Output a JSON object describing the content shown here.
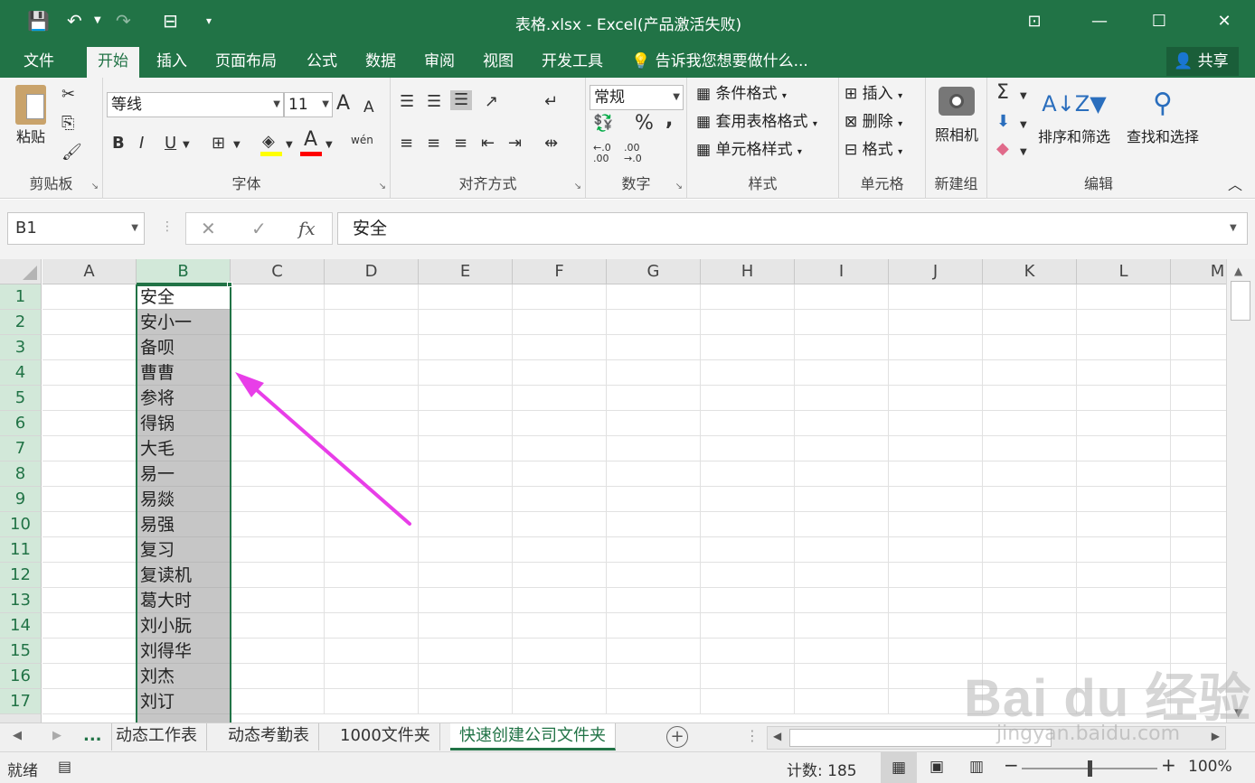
{
  "titlebar": {
    "title": "表格.xlsx - Excel(产品激活失败)",
    "save_icon": "💾",
    "undo_icon": "↶",
    "redo_icon": "↷",
    "customize_icon": "⊟",
    "more_icon": "▾",
    "ribbon_display_icon": "⊡",
    "minimize_icon": "—",
    "maximize_icon": "☐",
    "close_icon": "✕"
  },
  "tabs": [
    "文件",
    "开始",
    "插入",
    "页面布局",
    "公式",
    "数据",
    "审阅",
    "视图",
    "开发工具"
  ],
  "active_tab": "开始",
  "tell_me": "告诉我您想要做什么...",
  "tell_me_icon": "💡",
  "share": {
    "label": "共享",
    "icon": "👤"
  },
  "ribbon": {
    "clipboard": {
      "label": "剪贴板",
      "paste": "粘贴",
      "cut_icon": "✂",
      "copy_icon": "⎘",
      "format_painter_icon": "🖌"
    },
    "font": {
      "label": "字体",
      "font_name": "等线",
      "font_size": "11",
      "grow": "A",
      "shrink": "A",
      "bold": "B",
      "italic": "I",
      "underline": "U",
      "borders_icon": "⊞",
      "fill_icon": "◈",
      "font_color": "A",
      "phonetic": "wén",
      "fill_color": "#ffff00",
      "font_color_value": "#ff0000"
    },
    "alignment": {
      "label": "对齐方式"
    },
    "number": {
      "label": "数字",
      "format": "常规",
      "percent": "%",
      "comma": ",",
      "inc_decimal": "←.0 .00",
      "dec_decimal": ".00 →.0"
    },
    "styles": {
      "label": "样式",
      "conditional": "条件格式",
      "table": "套用表格格式",
      "cell_styles": "单元格样式"
    },
    "cells": {
      "label": "单元格",
      "insert": "插入",
      "delete": "删除",
      "format": "格式"
    },
    "newgroup": {
      "label": "新建组",
      "camera": "照相机"
    },
    "editing": {
      "label": "编辑",
      "sum": "Σ",
      "fill_icon": "⬇",
      "clear_icon": "◆",
      "sort": "排序和筛选",
      "find": "查找和选择"
    },
    "collapse_icon": "︿"
  },
  "formula_bar": {
    "name_box": "B1",
    "cancel_icon": "✕",
    "enter_icon": "✓",
    "fx": "fx",
    "content": "安全"
  },
  "grid": {
    "columns": [
      "A",
      "B",
      "C",
      "D",
      "E",
      "F",
      "G",
      "H",
      "I",
      "J",
      "K",
      "L",
      "M"
    ],
    "selected_column": "B",
    "rows": [
      "1",
      "2",
      "3",
      "4",
      "5",
      "6",
      "7",
      "8",
      "9",
      "10",
      "11",
      "12",
      "13",
      "14",
      "15",
      "16",
      "17"
    ],
    "column_b_values": [
      "安全",
      "安小一",
      "备呗",
      "曹曹",
      "参将",
      "得锅",
      "大毛",
      "易一",
      "易燚",
      "易强",
      "复习",
      "复读机",
      "葛大时",
      "刘小朊",
      "刘得华",
      "刘杰",
      "刘订"
    ]
  },
  "sheets": {
    "nav_prev": "◀",
    "nav_next": "▶",
    "ellipsis": "...",
    "tabs": [
      "动态工作表",
      "动态考勤表",
      "1000文件夹",
      "快速创建公司文件夹"
    ],
    "active": "快速创建公司文件夹",
    "add_icon": "+"
  },
  "statusbar": {
    "ready": "就绪",
    "count": "计数: 185",
    "zoom": "100%",
    "zoom_level": 1.0
  },
  "annotation": {
    "arrow_color": "#e83ee8"
  },
  "watermark": {
    "text": "Bai du 经验",
    "sub": "jingyan.baidu.com"
  }
}
